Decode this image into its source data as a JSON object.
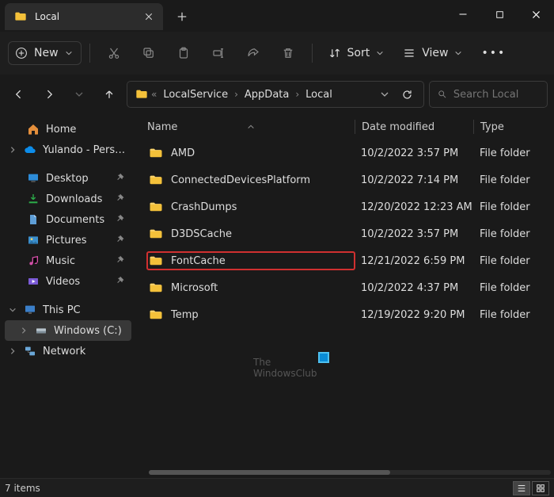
{
  "window": {
    "tab_title": "Local"
  },
  "toolbar": {
    "new_label": "New",
    "sort_label": "Sort",
    "view_label": "View"
  },
  "breadcrumb": {
    "overflow_indicator": "«",
    "parts": [
      "LocalService",
      "AppData",
      "Local"
    ]
  },
  "search": {
    "placeholder": "Search Local"
  },
  "sidebar": {
    "home": "Home",
    "cloud": "Yulando - Personal",
    "quick": [
      {
        "label": "Desktop",
        "kind": "desktop"
      },
      {
        "label": "Downloads",
        "kind": "downloads"
      },
      {
        "label": "Documents",
        "kind": "documents"
      },
      {
        "label": "Pictures",
        "kind": "pictures"
      },
      {
        "label": "Music",
        "kind": "music"
      },
      {
        "label": "Videos",
        "kind": "videos"
      }
    ],
    "this_pc": "This PC",
    "drive": "Windows (C:)",
    "network": "Network"
  },
  "columns": {
    "name": "Name",
    "date": "Date modified",
    "type": "Type"
  },
  "files": [
    {
      "name": "AMD",
      "date": "10/2/2022 3:57 PM",
      "type": "File folder"
    },
    {
      "name": "ConnectedDevicesPlatform",
      "date": "10/2/2022 7:14 PM",
      "type": "File folder"
    },
    {
      "name": "CrashDumps",
      "date": "12/20/2022 12:23 AM",
      "type": "File folder"
    },
    {
      "name": "D3DSCache",
      "date": "10/2/2022 3:57 PM",
      "type": "File folder"
    },
    {
      "name": "FontCache",
      "date": "12/21/2022 6:59 PM",
      "type": "File folder",
      "highlight": true
    },
    {
      "name": "Microsoft",
      "date": "10/2/2022 4:37 PM",
      "type": "File folder"
    },
    {
      "name": "Temp",
      "date": "12/19/2022 9:20 PM",
      "type": "File folder"
    }
  ],
  "status": {
    "items": "7 items"
  },
  "watermark": {
    "line1": "The",
    "line2": "WindowsClub"
  }
}
